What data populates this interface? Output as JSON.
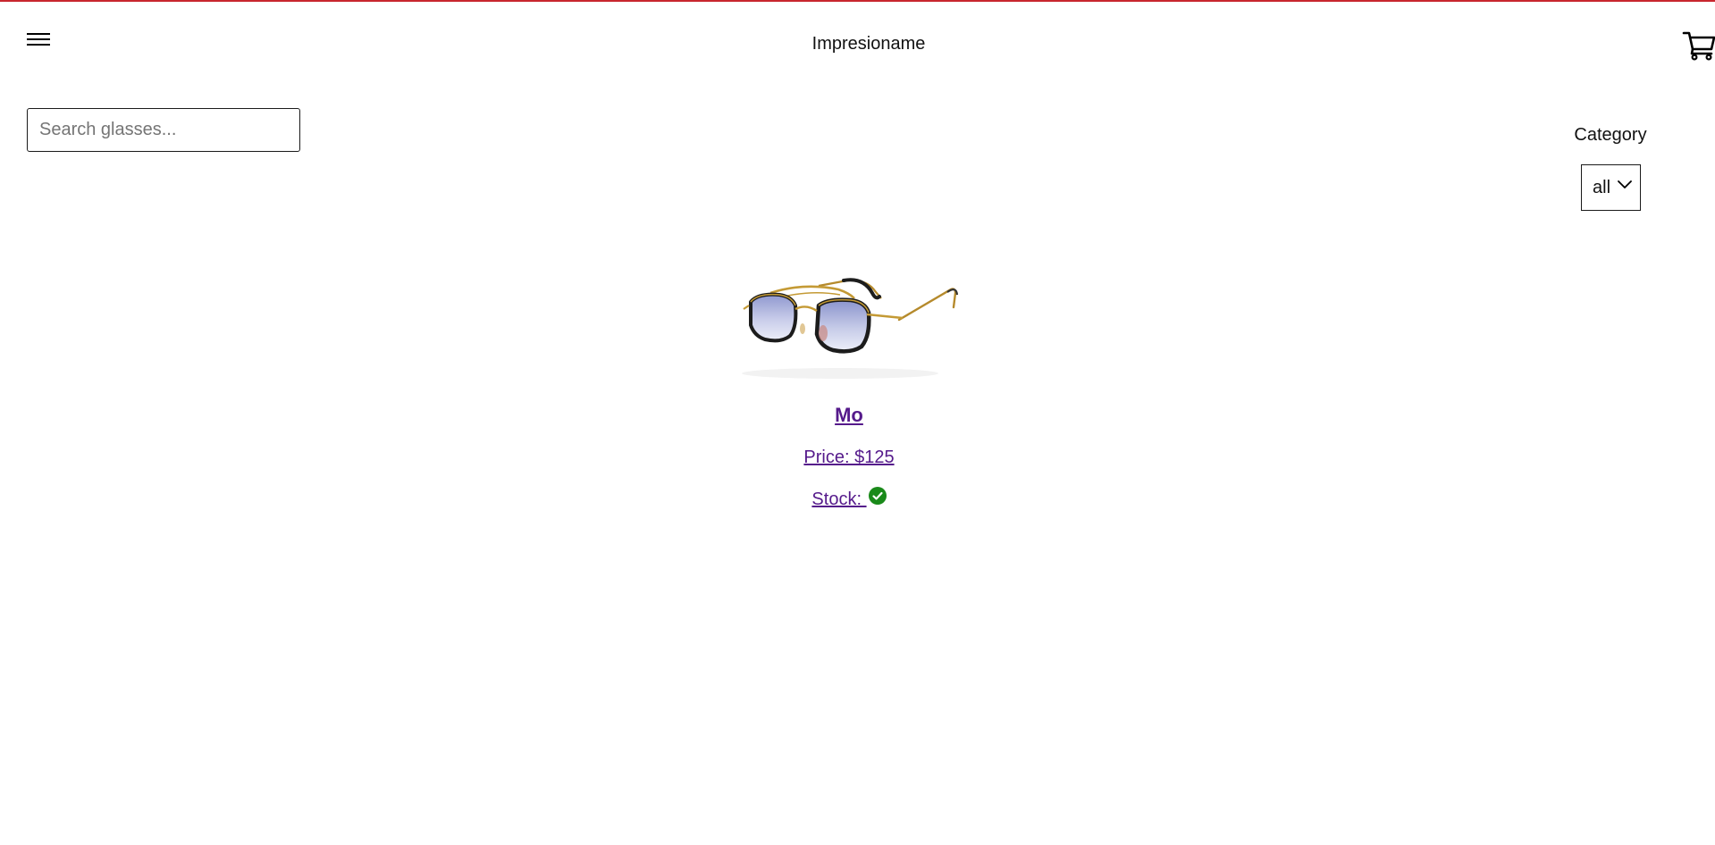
{
  "header": {
    "title": "Impresioname",
    "menu_icon": "hamburger-menu-icon",
    "cart_icon": "shopping-cart-icon"
  },
  "search": {
    "placeholder": "Search glasses...",
    "value": ""
  },
  "filter": {
    "label": "Category",
    "selected": "all"
  },
  "products": [
    {
      "name": "Mo",
      "price_label": "Price: $125",
      "stock_label": "Stock:",
      "in_stock": true,
      "image_icon": "aviator-sunglasses-image"
    }
  ],
  "colors": {
    "top_rule": "#c8262e",
    "link": "#551a8b",
    "in_stock": "#1a8a1a"
  }
}
